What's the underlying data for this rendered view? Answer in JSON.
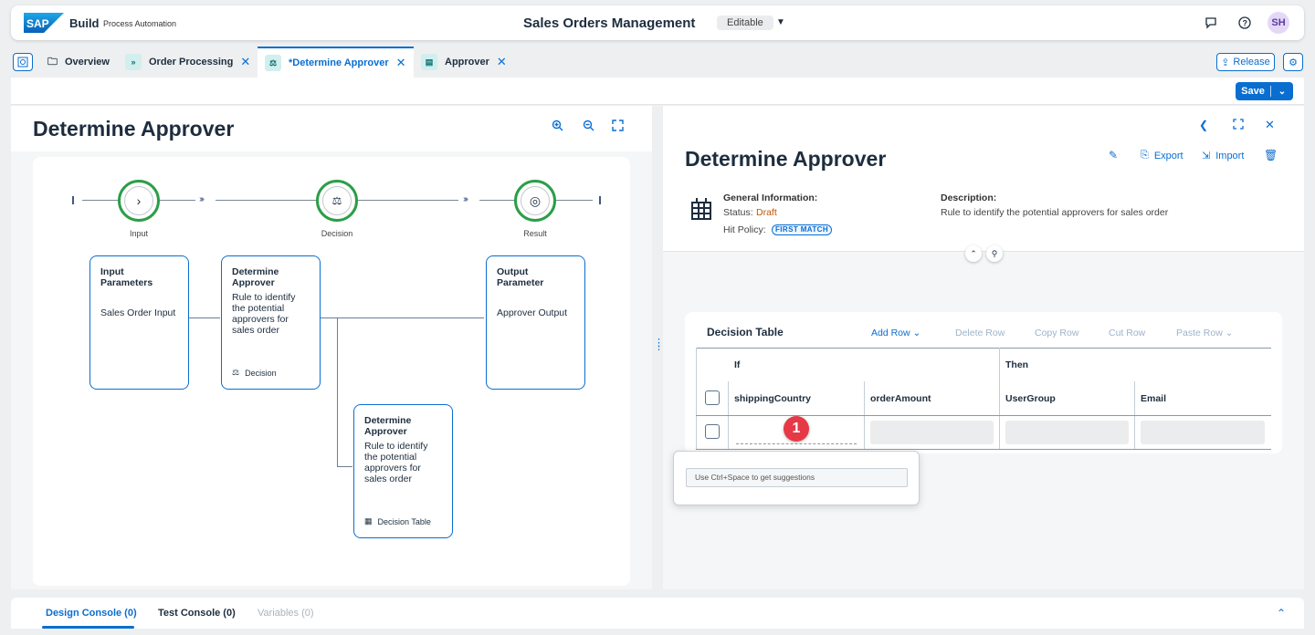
{
  "shell": {
    "brand": "Build",
    "brand_sub": "Process Automation",
    "title": "Sales Orders Management",
    "status": "Editable",
    "avatar": "SH"
  },
  "tabs": [
    {
      "label": "Overview"
    },
    {
      "label": "Order Processing"
    },
    {
      "label": "*Determine Approver"
    },
    {
      "label": "Approver"
    }
  ],
  "actions": {
    "release": "Release",
    "save": "Save"
  },
  "left": {
    "title": "Determine Approver",
    "nodes": [
      {
        "label": "Input"
      },
      {
        "label": "Decision"
      },
      {
        "label": "Result"
      }
    ],
    "cards": {
      "input_title": "Input Parameters",
      "input_body": "Sales Order Input",
      "decision_title": "Determine Approver",
      "decision_body": "Rule to identify the potential approvers for sales order",
      "decision_foot": "Decision",
      "output_title": "Output Parameter",
      "output_body": "Approver Output",
      "table_title": "Determine Approver",
      "table_body": "Rule to identify the potential approvers for sales order",
      "table_foot": "Decision Table"
    }
  },
  "right": {
    "title": "Determine Approver",
    "export": "Export",
    "import": "Import",
    "general_label": "General Information:",
    "status_label": "Status:",
    "status_value": "Draft",
    "hit_policy_label": "Hit Policy:",
    "hit_policy_value": "FIRST MATCH",
    "description_label": "Description:",
    "description_value": "Rule to identify the potential approvers for sales order"
  },
  "decision_table": {
    "title": "Decision Table",
    "add_row": "Add Row",
    "delete_row": "Delete Row",
    "copy_row": "Copy Row",
    "cut_row": "Cut Row",
    "paste_row": "Paste Row",
    "if_label": "If",
    "then_label": "Then",
    "columns": [
      "shippingCountry",
      "orderAmount",
      "UserGroup",
      "Email"
    ],
    "step_marker": "1",
    "suggestion_placeholder": "Use Ctrl+Space to get suggestions"
  },
  "console": {
    "tabs": [
      "Design Console (0)",
      "Test Console (0)",
      "Variables (0)"
    ]
  },
  "colors": {
    "accent": "#0a6ed1",
    "node_ring": "#2b9e47",
    "draft": "#c35500",
    "marker": "#e63946"
  }
}
